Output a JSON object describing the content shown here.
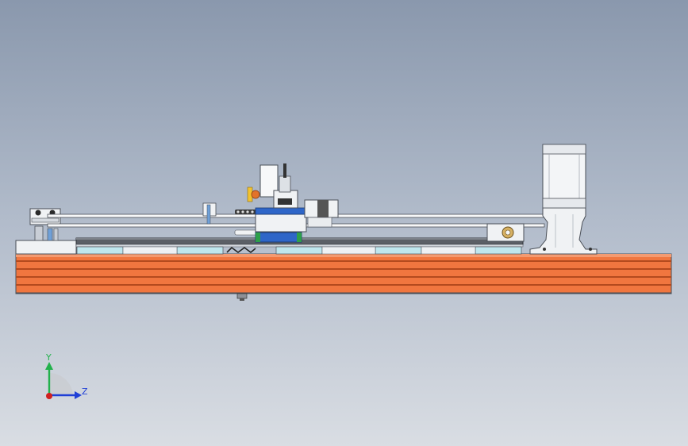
{
  "viewport": {
    "background_top": "#8a98ad",
    "background_bottom": "#d9dde3"
  },
  "model": {
    "profile_color": "#f0763f",
    "profile_line_color": "#b34a1e",
    "part_fill": "#f0f2f4",
    "part_stroke": "#4a4f57",
    "slider_color": "#2f66c8",
    "cyan_block": "#bfe6ee",
    "green_accent": "#2da04a",
    "knob_color": "#e2732a"
  },
  "triad": {
    "y_label": "Y",
    "z_label": "Z",
    "y_color": "#22b14c",
    "z_color": "#1f3fd6",
    "x_color": "#d12020"
  }
}
